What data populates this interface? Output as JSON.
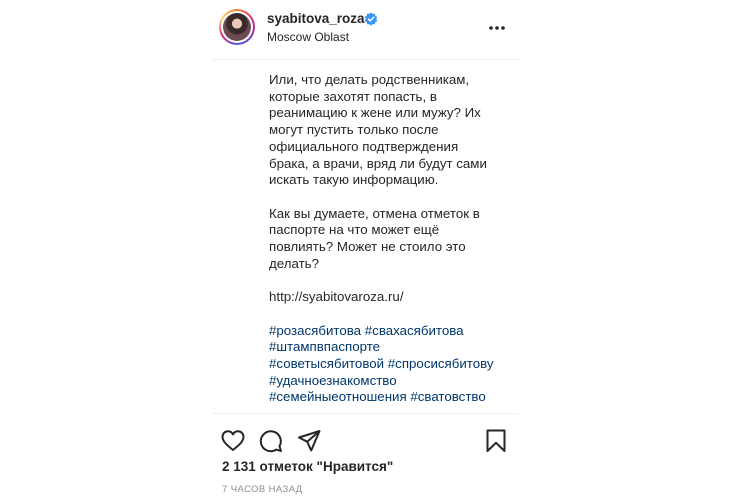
{
  "header": {
    "username": "syabitova_roza",
    "location": "Moscow Oblast",
    "verified_color": "#3897f0"
  },
  "caption": {
    "lines": [
      "Или, что делать родственникам,",
      "которые захотят попасть, в",
      "реанимацию к жене или мужу? Их",
      "могут пустить только после",
      "официального подтверждения",
      "брака, а врачи, вряд ли будут сами",
      "искать такую информацию.",
      "",
      "Как вы думаете, отмена отметок в",
      "паспорте на что может ещё",
      "повлиять? Может не стоило это",
      "делать?",
      "",
      "http://syabitovaroza.ru/",
      ""
    ],
    "hashtag_lines": [
      [
        "#розасябитова",
        "#свахасябитова"
      ],
      [
        "#штампвпаспорте"
      ],
      [
        "#советысябитовой",
        "#спросисябитову"
      ],
      [
        "#удачноезнакомство"
      ],
      [
        "#семейныеотношения",
        "#сватовство"
      ]
    ]
  },
  "icons": {
    "like": "heart-icon",
    "comment": "comment-icon",
    "share": "paper-plane-icon",
    "save": "bookmark-icon",
    "more": "more-options-icon"
  },
  "likes_text": "2 131 отметок \"Нравится\"",
  "time_text": "7 ЧАСОВ НАЗАД",
  "colors": {
    "hashtag": "#00376b",
    "text": "#262626",
    "muted": "#8e8e8e"
  }
}
